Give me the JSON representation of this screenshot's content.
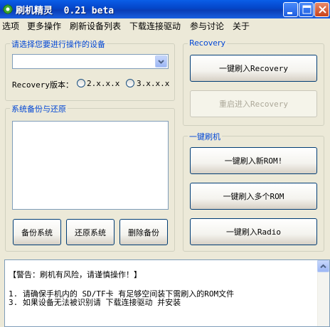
{
  "window": {
    "title": "刷机精灵  0.21 beta"
  },
  "menu": [
    "选项",
    "更多操作",
    "刷新设备列表",
    "下载连接驱动",
    "参与讨论",
    "关于"
  ],
  "device_group": {
    "label": "请选择您要进行操作的设备",
    "combo_value": "",
    "recovery_version_label": "Recovery版本：",
    "radio_options": [
      "2.x.x.x",
      "3.x.x.x"
    ]
  },
  "backup_group": {
    "label": "系统备份与还原",
    "buttons": [
      "备份系统",
      "还原系统",
      "删除备份"
    ]
  },
  "recovery_group": {
    "label": "Recovery",
    "flash_recovery": "一键刷入Recovery",
    "reboot_recovery": "重启进入Recovery"
  },
  "flash_group": {
    "label": "一键刷机",
    "flash_new_rom": "一键刷入新ROM!",
    "flash_multi_rom": "一键刷入多个ROM",
    "flash_radio": "一键刷入Radio"
  },
  "log": {
    "lines": [
      "【警告：刷机有风险，请谨慎操作！】",
      "1. 请确保手机内的 SD/TF卡 有足够空间装下需刷入的ROM文件",
      "3. 如果设备无法被识别请 下载连接驱动 并安装"
    ]
  },
  "colors": {
    "titlebar": "#0A5EE8",
    "group_label": "#0046D5",
    "window_bg": "#ECE9D8"
  }
}
